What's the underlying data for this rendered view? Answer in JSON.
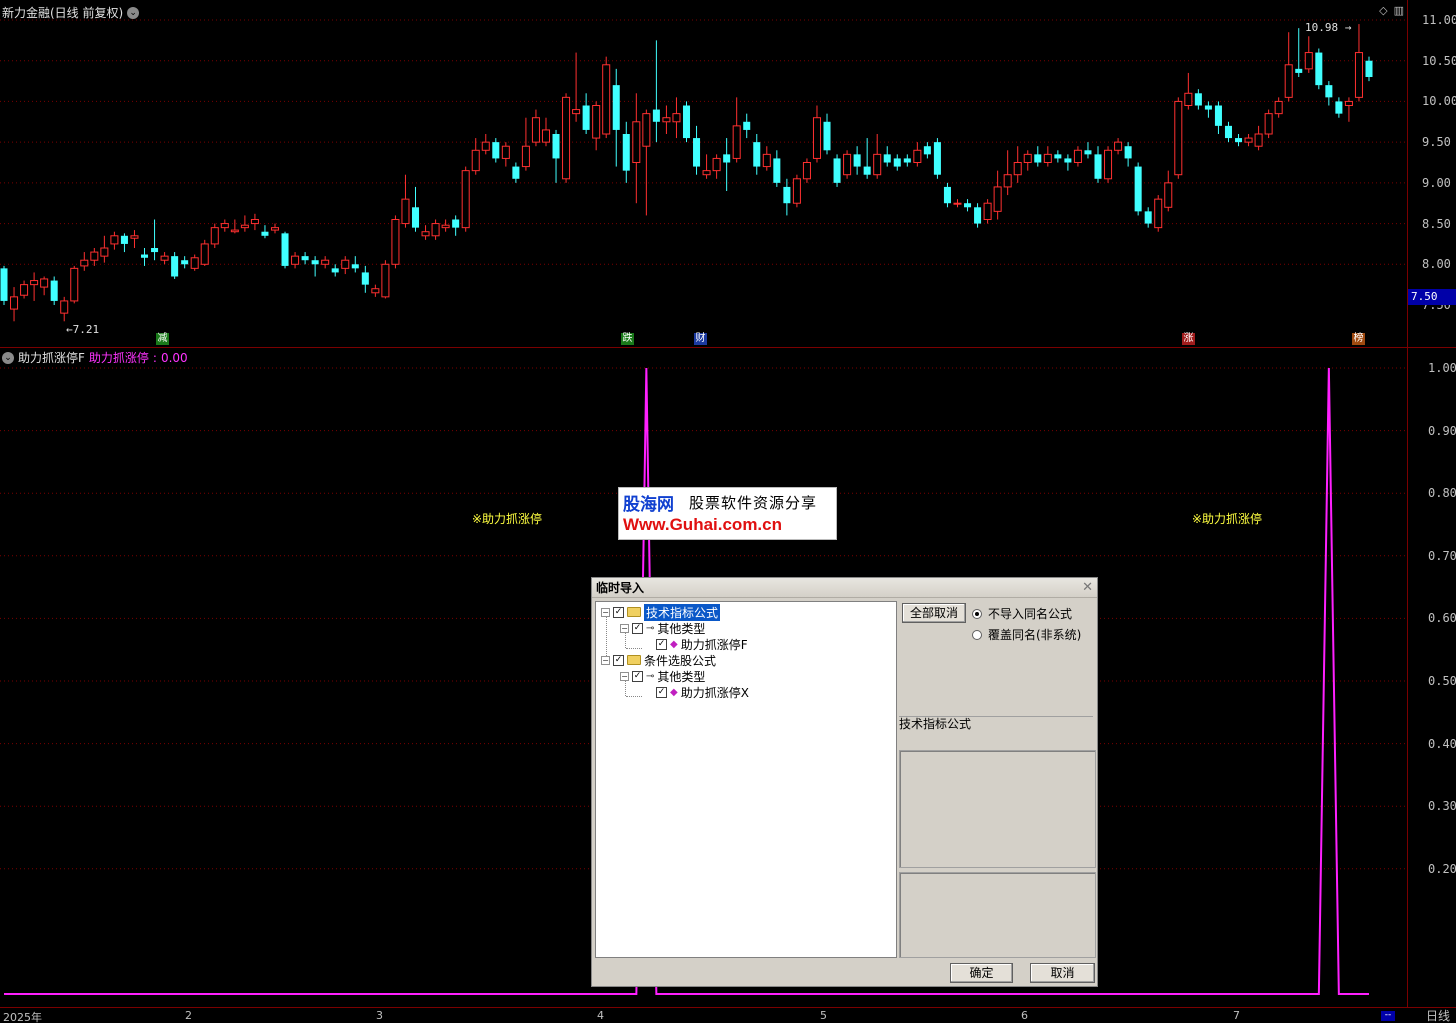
{
  "header": {
    "stock_title": "新力金融(日线 前复权)",
    "indicator_name": "助力抓涨停F",
    "indicator_label": "助力抓涨停",
    "indicator_value": "0.00"
  },
  "price_axis": {
    "ticks": [
      "11.00",
      "10.50",
      "10.00",
      "9.50",
      "9.00",
      "8.50",
      "8.00",
      "7.50"
    ],
    "last_price": "7.50"
  },
  "indicator_axis": {
    "ticks": [
      "1.00",
      "0.90",
      "0.80",
      "0.70",
      "0.60",
      "0.50",
      "0.40",
      "0.30",
      "0.20"
    ]
  },
  "extremes": {
    "high": "10.98",
    "low": "7.21"
  },
  "events": [
    {
      "label": "减",
      "color": "#1a7a1a"
    },
    {
      "label": "跌",
      "color": "#1a7a1a"
    },
    {
      "label": "财",
      "color": "#1c3aa0"
    },
    {
      "label": "涨",
      "color": "#a01c1c"
    },
    {
      "label": "榜",
      "color": "#a04a10"
    }
  ],
  "signals": [
    "※助力抓涨停",
    "※助力抓涨停"
  ],
  "date_axis": [
    "2025年",
    "2",
    "3",
    "4",
    "5",
    "6",
    "7"
  ],
  "bottom_right": "日线",
  "bottom_mini": "--",
  "colors": {
    "up": "#ff3030",
    "down": "#40ffff",
    "indicator": "#ff20ff",
    "grid": "#7a0000"
  },
  "watermark": {
    "logo": "股海网",
    "tagline": "股票软件资源分享",
    "url": "Www.Guhai.com.cn"
  },
  "dialog": {
    "title": "临时导入",
    "tree": [
      {
        "label": "技术指标公式",
        "level": 0,
        "icon": "folder-icon",
        "selected": true
      },
      {
        "label": "其他类型",
        "level": 1,
        "icon": "key-icon",
        "selected": false
      },
      {
        "label": "助力抓涨停F",
        "level": 2,
        "icon": "formula-icon",
        "selected": false
      },
      {
        "label": "条件选股公式",
        "level": 0,
        "icon": "folder-icon",
        "selected": false
      },
      {
        "label": "其他类型",
        "level": 1,
        "icon": "key-icon",
        "selected": false
      },
      {
        "label": "助力抓涨停X",
        "level": 2,
        "icon": "formula-icon",
        "selected": false
      }
    ],
    "deselect_all": "全部取消",
    "radio_options": [
      {
        "label": "不导入同名公式",
        "checked": true
      },
      {
        "label": "覆盖同名(非系统)",
        "checked": false
      }
    ],
    "group_title": "技术指标公式",
    "ok": "确定",
    "cancel": "取消"
  },
  "chart_data": {
    "type": "candlestick",
    "price_range": [
      7.2,
      11.1
    ],
    "candles": [
      [
        7.95,
        7.55,
        7.98,
        7.5
      ],
      [
        7.45,
        7.6,
        7.72,
        7.3
      ],
      [
        7.62,
        7.75,
        7.8,
        7.58
      ],
      [
        7.75,
        7.8,
        7.9,
        7.55
      ],
      [
        7.72,
        7.82,
        7.85,
        7.62
      ],
      [
        7.8,
        7.55,
        7.85,
        7.5
      ],
      [
        7.4,
        7.55,
        7.6,
        7.3
      ],
      [
        7.55,
        7.95,
        7.98,
        7.52
      ],
      [
        7.98,
        8.05,
        8.15,
        7.92
      ],
      [
        8.05,
        8.15,
        8.2,
        7.98
      ],
      [
        8.1,
        8.2,
        8.35,
        8.02
      ],
      [
        8.25,
        8.35,
        8.4,
        8.18
      ],
      [
        8.35,
        8.25,
        8.38,
        8.15
      ],
      [
        8.32,
        8.35,
        8.42,
        8.2
      ],
      [
        8.12,
        8.08,
        8.2,
        7.98
      ],
      [
        8.2,
        8.15,
        8.55,
        8.05
      ],
      [
        8.05,
        8.1,
        8.15,
        8.0
      ],
      [
        8.1,
        7.85,
        8.15,
        7.82
      ],
      [
        8.05,
        8.0,
        8.1,
        7.95
      ],
      [
        7.95,
        8.08,
        8.12,
        7.92
      ],
      [
        8.0,
        8.25,
        8.3,
        7.98
      ],
      [
        8.25,
        8.45,
        8.5,
        8.2
      ],
      [
        8.45,
        8.5,
        8.55,
        8.4
      ],
      [
        8.4,
        8.42,
        8.55,
        8.38
      ],
      [
        8.45,
        8.48,
        8.6,
        8.4
      ],
      [
        8.5,
        8.55,
        8.62,
        8.42
      ],
      [
        8.4,
        8.35,
        8.48,
        8.32
      ],
      [
        8.42,
        8.45,
        8.5,
        8.38
      ],
      [
        8.38,
        7.98,
        8.4,
        7.95
      ],
      [
        8.0,
        8.1,
        8.15,
        7.95
      ],
      [
        8.1,
        8.05,
        8.15,
        8.0
      ],
      [
        8.05,
        8.0,
        8.1,
        7.85
      ],
      [
        8.0,
        8.05,
        8.1,
        7.95
      ],
      [
        7.95,
        7.9,
        8.0,
        7.85
      ],
      [
        7.95,
        8.05,
        8.1,
        7.88
      ],
      [
        8.0,
        7.95,
        8.1,
        7.9
      ],
      [
        7.9,
        7.75,
        7.98,
        7.65
      ],
      [
        7.65,
        7.7,
        7.75,
        7.6
      ],
      [
        7.6,
        8.0,
        8.05,
        7.58
      ],
      [
        8.0,
        8.55,
        8.6,
        7.95
      ],
      [
        8.5,
        8.8,
        9.1,
        8.45
      ],
      [
        8.7,
        8.45,
        8.95,
        8.4
      ],
      [
        8.35,
        8.4,
        8.48,
        8.3
      ],
      [
        8.35,
        8.5,
        8.55,
        8.3
      ],
      [
        8.45,
        8.48,
        8.55,
        8.4
      ],
      [
        8.55,
        8.45,
        8.6,
        8.35
      ],
      [
        8.45,
        9.15,
        9.2,
        8.4
      ],
      [
        9.15,
        9.4,
        9.55,
        9.1
      ],
      [
        9.4,
        9.5,
        9.6,
        9.35
      ],
      [
        9.5,
        9.3,
        9.55,
        9.25
      ],
      [
        9.3,
        9.45,
        9.5,
        9.2
      ],
      [
        9.2,
        9.05,
        9.25,
        9.0
      ],
      [
        9.2,
        9.45,
        9.8,
        9.15
      ],
      [
        9.5,
        9.8,
        9.9,
        9.45
      ],
      [
        9.5,
        9.65,
        9.8,
        9.45
      ],
      [
        9.6,
        9.3,
        9.65,
        9.0
      ],
      [
        9.05,
        10.05,
        10.1,
        9.0
      ],
      [
        9.85,
        9.9,
        10.6,
        9.75
      ],
      [
        9.95,
        9.65,
        10.1,
        9.6
      ],
      [
        9.55,
        9.95,
        10.0,
        9.4
      ],
      [
        9.6,
        10.45,
        10.55,
        9.55
      ],
      [
        10.2,
        9.65,
        10.4,
        9.2
      ],
      [
        9.6,
        9.15,
        9.75,
        9.0
      ],
      [
        9.25,
        9.75,
        10.1,
        8.75
      ],
      [
        9.45,
        9.85,
        9.9,
        8.6
      ],
      [
        9.9,
        9.75,
        10.75,
        9.5
      ],
      [
        9.75,
        9.8,
        9.95,
        9.6
      ],
      [
        9.75,
        9.85,
        10.05,
        9.55
      ],
      [
        9.95,
        9.55,
        10.0,
        9.5
      ],
      [
        9.55,
        9.2,
        9.7,
        9.1
      ],
      [
        9.1,
        9.15,
        9.35,
        9.05
      ],
      [
        9.15,
        9.3,
        9.35,
        9.05
      ],
      [
        9.35,
        9.25,
        9.55,
        8.9
      ],
      [
        9.3,
        9.7,
        10.05,
        9.25
      ],
      [
        9.75,
        9.65,
        9.85,
        9.55
      ],
      [
        9.5,
        9.2,
        9.6,
        9.1
      ],
      [
        9.2,
        9.35,
        9.45,
        9.15
      ],
      [
        9.3,
        9.0,
        9.4,
        8.95
      ],
      [
        8.95,
        8.75,
        9.05,
        8.6
      ],
      [
        8.75,
        9.05,
        9.1,
        8.7
      ],
      [
        9.05,
        9.25,
        9.3,
        9.0
      ],
      [
        9.3,
        9.8,
        9.95,
        9.25
      ],
      [
        9.75,
        9.4,
        9.85,
        9.35
      ],
      [
        9.3,
        9.0,
        9.35,
        8.95
      ],
      [
        9.1,
        9.35,
        9.4,
        9.05
      ],
      [
        9.35,
        9.2,
        9.45,
        9.1
      ],
      [
        9.2,
        9.1,
        9.55,
        9.05
      ],
      [
        9.1,
        9.35,
        9.6,
        9.05
      ],
      [
        9.35,
        9.25,
        9.45,
        9.2
      ],
      [
        9.3,
        9.2,
        9.35,
        9.15
      ],
      [
        9.3,
        9.25,
        9.35,
        9.2
      ],
      [
        9.25,
        9.4,
        9.5,
        9.2
      ],
      [
        9.45,
        9.35,
        9.5,
        9.3
      ],
      [
        9.5,
        9.1,
        9.55,
        9.05
      ],
      [
        8.95,
        8.75,
        9.0,
        8.7
      ],
      [
        8.75,
        8.75,
        8.8,
        8.7
      ],
      [
        8.75,
        8.7,
        8.8,
        8.65
      ],
      [
        8.7,
        8.5,
        8.75,
        8.45
      ],
      [
        8.55,
        8.75,
        8.8,
        8.5
      ],
      [
        8.65,
        8.95,
        9.15,
        8.55
      ],
      [
        8.95,
        9.1,
        9.4,
        8.85
      ],
      [
        9.1,
        9.25,
        9.45,
        9.0
      ],
      [
        9.25,
        9.35,
        9.4,
        9.15
      ],
      [
        9.35,
        9.25,
        9.45,
        9.2
      ],
      [
        9.25,
        9.35,
        9.45,
        9.2
      ],
      [
        9.35,
        9.3,
        9.4,
        9.25
      ],
      [
        9.3,
        9.25,
        9.35,
        9.15
      ],
      [
        9.25,
        9.4,
        9.45,
        9.2
      ],
      [
        9.4,
        9.35,
        9.5,
        9.3
      ],
      [
        9.35,
        9.05,
        9.45,
        9.0
      ],
      [
        9.05,
        9.4,
        9.45,
        9.0
      ],
      [
        9.4,
        9.5,
        9.55,
        9.35
      ],
      [
        9.45,
        9.3,
        9.5,
        9.2
      ],
      [
        9.2,
        8.65,
        9.25,
        8.6
      ],
      [
        8.65,
        8.5,
        8.7,
        8.45
      ],
      [
        8.45,
        8.8,
        8.85,
        8.4
      ],
      [
        8.7,
        9.0,
        9.15,
        8.65
      ],
      [
        9.1,
        10.0,
        10.05,
        9.05
      ],
      [
        9.95,
        10.1,
        10.35,
        9.9
      ],
      [
        10.1,
        9.95,
        10.15,
        9.9
      ],
      [
        9.95,
        9.9,
        10.0,
        9.8
      ],
      [
        9.95,
        9.7,
        10.0,
        9.6
      ],
      [
        9.7,
        9.55,
        9.75,
        9.5
      ],
      [
        9.55,
        9.5,
        9.6,
        9.45
      ],
      [
        9.5,
        9.55,
        9.6,
        9.45
      ],
      [
        9.45,
        9.6,
        9.7,
        9.4
      ],
      [
        9.6,
        9.85,
        9.9,
        9.55
      ],
      [
        9.85,
        10.0,
        10.05,
        9.8
      ],
      [
        10.05,
        10.45,
        10.85,
        10.0
      ],
      [
        10.4,
        10.35,
        10.9,
        10.3
      ],
      [
        10.4,
        10.6,
        10.8,
        10.35
      ],
      [
        10.6,
        10.2,
        10.65,
        10.15
      ],
      [
        10.2,
        10.05,
        10.25,
        9.95
      ],
      [
        10.0,
        9.85,
        10.05,
        9.8
      ],
      [
        9.95,
        10.0,
        10.05,
        9.75
      ],
      [
        10.05,
        10.6,
        10.95,
        10.0
      ],
      [
        10.5,
        10.3,
        10.55,
        10.25
      ]
    ],
    "indicator": {
      "name": "助力抓涨停",
      "range": [
        0,
        1.0
      ],
      "spikes_at_candle_index": [
        64,
        132
      ],
      "base_value": 0
    }
  }
}
